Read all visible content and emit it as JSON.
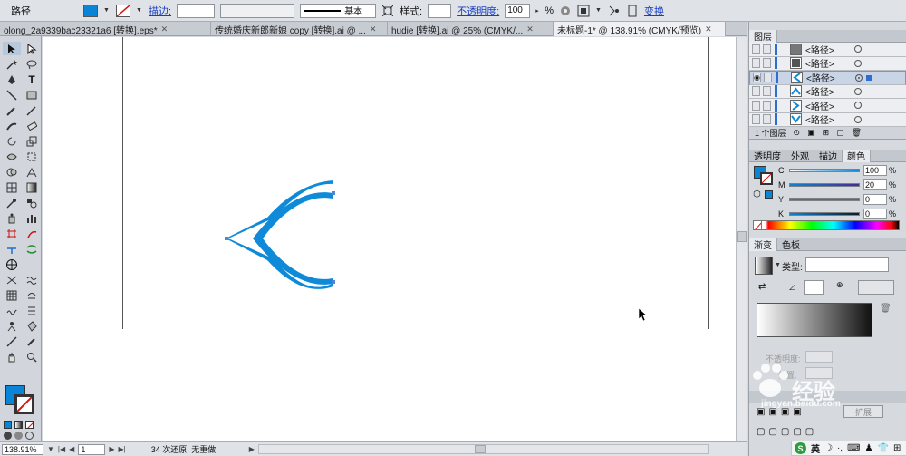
{
  "control_bar": {
    "object_type": "路径",
    "fill_color": "#0a84d6",
    "stroke_label": "描边:",
    "stroke_profile": "基本",
    "style_label": "样式:",
    "opacity_label": "不透明度:",
    "opacity_value": "100",
    "opacity_unit": "%",
    "transform_label": "变换"
  },
  "tabs": [
    {
      "label": "olong_2a9339bac23321a6 [转换].eps*",
      "active": false
    },
    {
      "label": "传统婚庆新郎新娘 copy [转换].ai @ ...",
      "active": false
    },
    {
      "label": "hudie [转换].ai @ 25% (CMYK/...",
      "active": false
    },
    {
      "label": "未标题-1* @ 138.91% (CMYK/预览)",
      "active": true
    }
  ],
  "canvas": {
    "shape_color": "#0f8ad8"
  },
  "status_bar": {
    "zoom": "138.91%",
    "page": "1",
    "message": "34 次还原; 无重做"
  },
  "layers_panel": {
    "title": "图层",
    "rows": [
      {
        "name": "<路径>",
        "selected": false
      },
      {
        "name": "<路径>",
        "selected": false
      },
      {
        "name": "<路径>",
        "selected": true
      },
      {
        "name": "<路径>",
        "selected": false
      },
      {
        "name": "<路径>",
        "selected": false
      },
      {
        "name": "<路径>",
        "selected": false
      }
    ],
    "footer": "1 个图层"
  },
  "color_panel": {
    "tabs": [
      "透明度",
      "外观",
      "描边",
      "颜色"
    ],
    "active_tab": "颜色",
    "channels": [
      {
        "label": "C",
        "value": "100",
        "color": "#0a84d6",
        "fill": 1.0
      },
      {
        "label": "M",
        "value": "20",
        "color": "#c2157e",
        "fill": 0.2
      },
      {
        "label": "Y",
        "value": "0",
        "color": "#e1cf14",
        "fill": 0
      },
      {
        "label": "K",
        "value": "0",
        "color": "#111111",
        "fill": 0
      }
    ],
    "unit": "%"
  },
  "gradient_panel": {
    "tabs": [
      "渐变",
      "色板"
    ],
    "type_label": "类型:",
    "opacity_label": "不透明度:",
    "location_label": "位置:"
  },
  "bottom_panel": {
    "expand_label": "扩展"
  },
  "taskbar": {
    "ime_label": "英"
  },
  "watermark": {
    "text": "经验",
    "url": "jingyan.baidu.com"
  }
}
